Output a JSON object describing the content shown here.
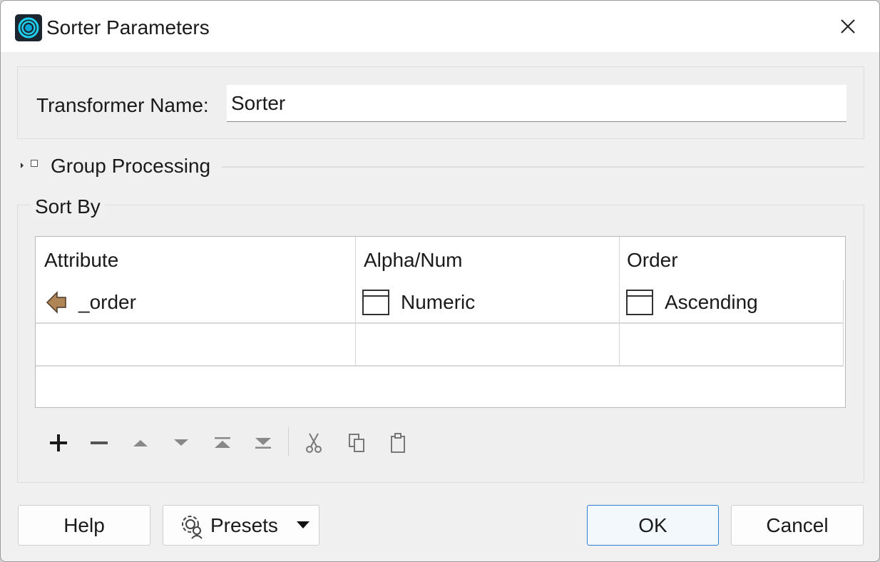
{
  "window": {
    "title": "Sorter Parameters",
    "icons": {
      "app": "fme-app-icon",
      "close": "close-icon"
    }
  },
  "transformer": {
    "label": "Transformer Name:",
    "value": "Sorter"
  },
  "group_processing": {
    "label": "Group Processing",
    "checked": false,
    "expanded": false
  },
  "sort_by": {
    "legend": "Sort By",
    "columns": [
      "Attribute",
      "Alpha/Num",
      "Order"
    ],
    "rows": [
      {
        "attribute": "_order",
        "alpha_num": "Numeric",
        "order": "Ascending"
      }
    ],
    "toolbar": [
      "add-icon",
      "remove-icon",
      "move-up-icon",
      "move-down-icon",
      "move-top-icon",
      "move-bottom-icon",
      "cut-icon",
      "copy-icon",
      "paste-icon"
    ]
  },
  "buttons": {
    "help": "Help",
    "presets": "Presets",
    "ok": "OK",
    "cancel": "Cancel"
  },
  "colors": {
    "attribute_icon": "#b08555",
    "primary_border": "#2a7fd4",
    "app_icon_ring": "#20d0f0"
  }
}
